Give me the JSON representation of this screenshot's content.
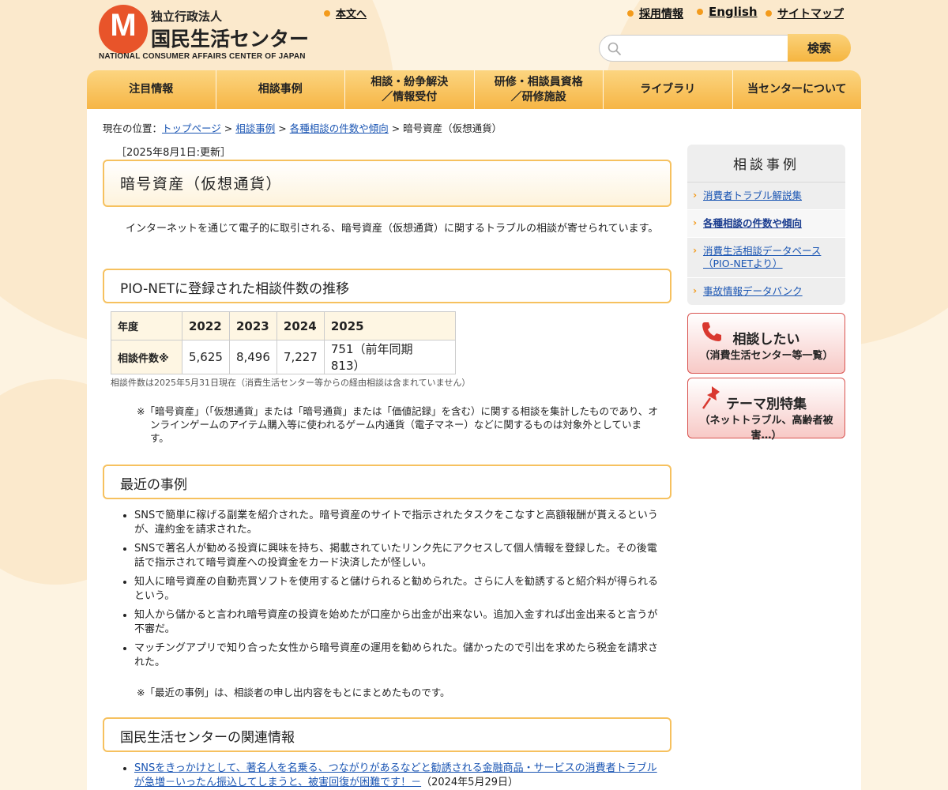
{
  "header": {
    "logo_mark": "M",
    "logo_sub": "独立行政法人",
    "logo_main": "国民生活センター",
    "logo_en": "NATIONAL CONSUMER AFFAIRS CENTER OF JAPAN",
    "skip_link": "本文へ",
    "links": [
      "採用情報",
      "English",
      "サイトマップ"
    ],
    "search_placeholder": "",
    "search_button": "検索"
  },
  "nav": {
    "items": [
      "注目情報",
      "相談事例",
      "相談・紛争解決\n／情報受付",
      "研修・相談員資格\n／研修施設",
      "ライブラリ",
      "当センターについて"
    ]
  },
  "breadcrumb": {
    "prefix": "現在の位置：",
    "links": [
      "トップページ",
      "相談事例",
      "各種相談の件数や傾向"
    ],
    "separator": ">",
    "current": "暗号資産（仮想通貨）"
  },
  "main": {
    "updated": "［2025年8月1日:更新］",
    "title": "暗号資産（仮想通貨）",
    "intro": "インターネットを通じて電子的に取引される、暗号資産（仮想通貨）に関するトラブルの相談が寄せられています。",
    "section_pionet": "PIO-NETに登録された相談件数の推移",
    "table": {
      "header_label": "年度",
      "years": [
        "2022",
        "2023",
        "2024",
        "2025"
      ],
      "row_label": "相談件数※",
      "counts": [
        "5,625",
        "8,496",
        "7,227",
        "751（前年同期　813）"
      ]
    },
    "stats_note": "相談件数は2025年5月31日現在（消費生活センター等からの経由相談は含まれていません）",
    "remark": "※「暗号資産」（「仮想通貨」または「暗号通貨」または「価値記録」を含む）に関する相談を集計したものであり、オンラインゲームのアイテム購入等に使われるゲーム内通貨（電子マネー）などに関するものは対象外としています。",
    "section_cases": "最近の事例",
    "cases": [
      "SNSで簡単に稼げる副業を紹介された。暗号資産のサイトで指示されたタスクをこなすと高額報酬が貰えるというが、違約金を請求された。",
      "SNSで著名人が勧める投資に興味を持ち、掲載されていたリンク先にアクセスして個人情報を登録した。その後電話で指示されて暗号資産への投資金をカード決済したが怪しい。",
      "知人に暗号資産の自動売買ソフトを使用すると儲けられると勧められた。さらに人を勧誘すると紹介料が得られるという。",
      "知人から儲かると言われ暗号資産の投資を始めたが口座から出金が出来ない。追加入金すれば出金出来ると言うが不審だ。",
      "マッチングアプリで知り合った女性から暗号資産の運用を勧められた。儲かったので引出を求めたら税金を請求された。"
    ],
    "cases_note": "※「最近の事例」は、相談者の申し出内容をもとにまとめたものです。",
    "section_related": "国民生活センターの関連情報",
    "related": [
      {
        "link": "SNSをきっかけとして、著名人を名乗る、つながりがあるなどと勧誘される金融商品・サービスの消費者トラブルが急増－いったん振込してしまうと、被害回復が困難です！－",
        "date": "（2024年5月29日）"
      }
    ]
  },
  "sidebar": {
    "title": "相談事例",
    "items": [
      "消費者トラブル解説集",
      "各種相談の件数や傾向",
      "消費生活相談データベース（PIO-NETより）",
      "事故情報データバンク"
    ],
    "banner1_main": "相談したい",
    "banner1_sub": "（消費生活センター等一覧）",
    "banner2_main": "テーマ別特集",
    "banner2_sub": "（ネットトラブル、高齢者被害…）"
  }
}
